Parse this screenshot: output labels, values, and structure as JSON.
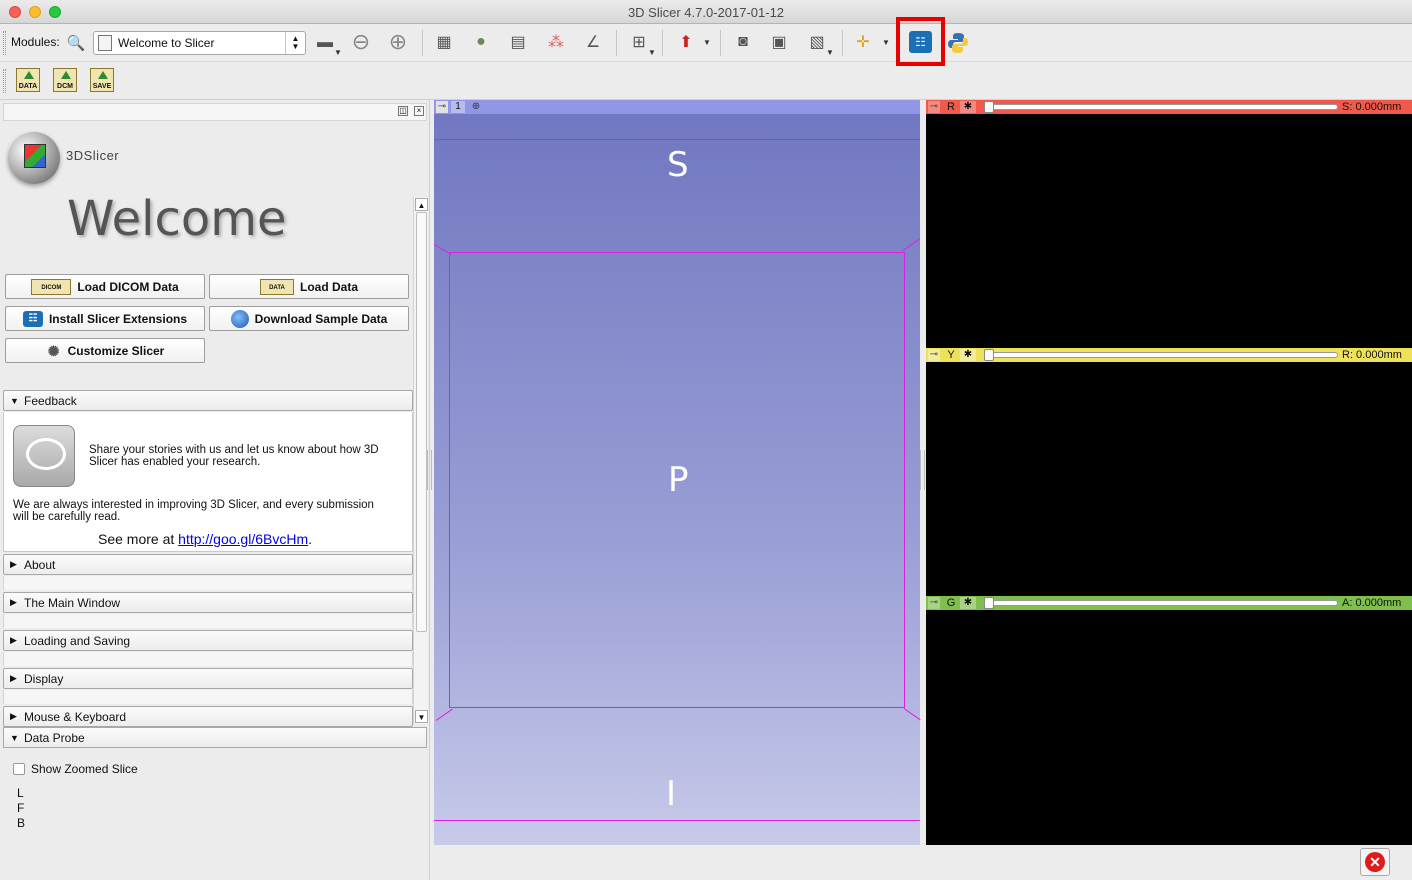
{
  "window": {
    "title": "3D Slicer 4.7.0-2017-01-12"
  },
  "toolbar": {
    "modules_label": "Modules:",
    "module_selected": "Welcome to Slicer",
    "icons": [
      "search-icon",
      "toolbar-toggle-icon",
      "back-icon",
      "forward-icon",
      "cube-3d-icon",
      "brain-icon",
      "slice-stack-icon",
      "volume-dots-icon",
      "curve-icon",
      "layout-icon",
      "arrow-marker-icon",
      "screenshot-icon",
      "scene-view-icon",
      "camera-list-icon",
      "crosshair-icon",
      "extension-manager-icon",
      "python-icon"
    ]
  },
  "toolbar2": {
    "data_label": "DATA",
    "dcm_label": "DCM",
    "save_label": "SAVE"
  },
  "left_panel": {
    "logo_text": "3DSlicer",
    "welcome_title": "Welcome",
    "buttons": {
      "load_dicom": "Load DICOM Data",
      "dicom_icon_text": "DICOM",
      "load_data": "Load Data",
      "data_icon_text": "DATA",
      "install_extensions": "Install Slicer Extensions",
      "download_sample": "Download Sample Data",
      "customize": "Customize Slicer"
    },
    "feedback": {
      "header": "Feedback",
      "line1": "Share your stories with us and let us know about how 3D",
      "line2": "Slicer has enabled your research.",
      "line3": "We are always interested in improving 3D Slicer, and every submission",
      "line4": "will be carefully read.",
      "see_more": "See more at",
      "link": "http://goo.gl/6BvcHm",
      "period": "."
    },
    "sections": [
      "About",
      "The Main Window",
      "Loading and Saving",
      "Display",
      "Mouse & Keyboard"
    ],
    "data_probe": {
      "header": "Data Probe",
      "show_zoomed": "Show Zoomed Slice",
      "rows": [
        "L",
        "F",
        "B"
      ]
    }
  },
  "view3d": {
    "tab_number": "1",
    "labels": {
      "top": "S",
      "center": "P",
      "bottom": "I"
    }
  },
  "slice_views": [
    {
      "letter": "R",
      "value": "S: 0.000mm",
      "color": "#f15a4a"
    },
    {
      "letter": "Y",
      "value": "R: 0.000mm",
      "color": "#ede25a"
    },
    {
      "letter": "G",
      "value": "A: 0.000mm",
      "color": "#7fbf4e"
    }
  ],
  "colors": {
    "highlight": "#e60000",
    "view3d_top": "#7076c0",
    "view3d_bottom": "#c7cae9",
    "box_line": "#e01ee0"
  }
}
